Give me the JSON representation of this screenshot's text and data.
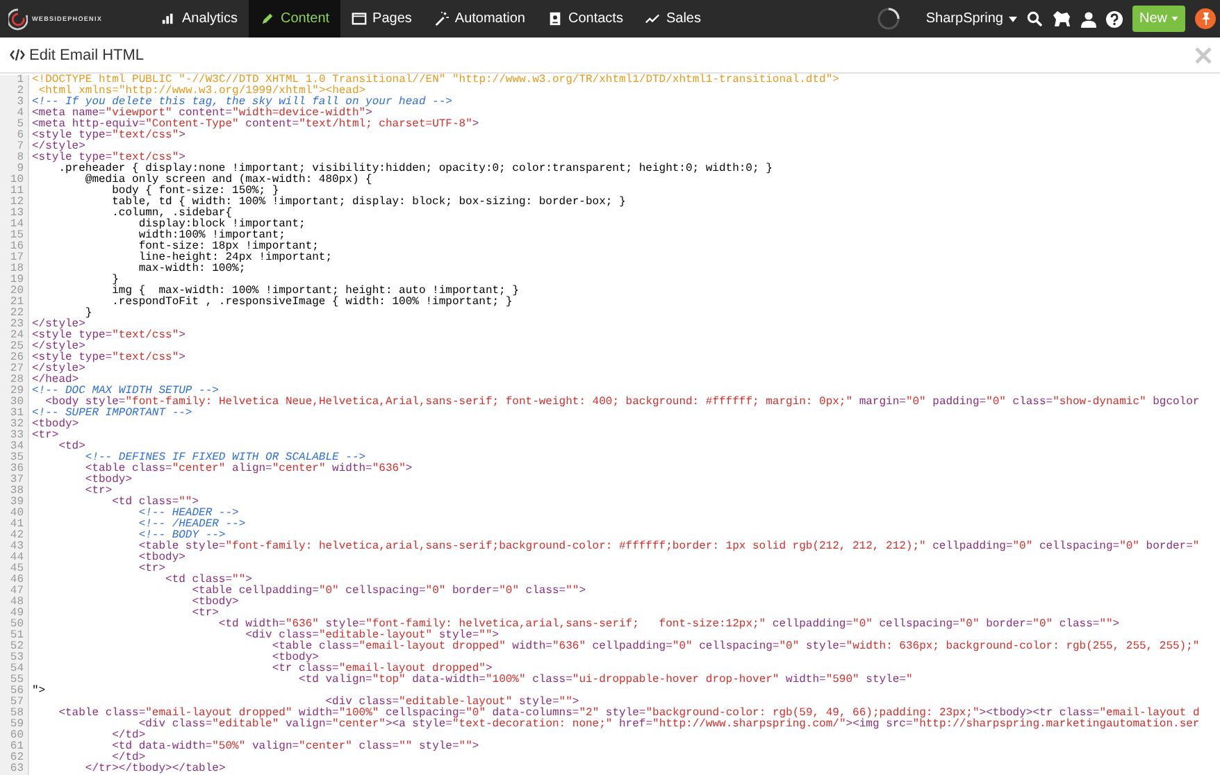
{
  "nav": {
    "logo_text": "WEBSIDEPHOENIX",
    "items": [
      {
        "label": "Analytics",
        "selected": false
      },
      {
        "label": "Content",
        "selected": true
      },
      {
        "label": "Pages",
        "selected": false
      },
      {
        "label": "Automation",
        "selected": false
      },
      {
        "label": "Contacts",
        "selected": false
      },
      {
        "label": "Sales",
        "selected": false
      }
    ],
    "account": "SharpSpring",
    "new_button": "New"
  },
  "editor": {
    "title": "Edit Email HTML",
    "lines": [
      {
        "n": "1",
        "kind": "doctype",
        "code": "<!DOCTYPE html PUBLIC \"-//W3C//DTD XHTML 1.0 Transitional//EN\" \"http://www.w3.org/TR/xhtml1/DTD/xhtml1-transitional.dtd\">"
      },
      {
        "n": "2",
        "kind": "doctype",
        "code": " <html xmlns=\"http://www.w3.org/1999/xhtml\"><head>"
      },
      {
        "n": "3",
        "kind": "code",
        "code": "<!-- If you delete this tag, the sky will fall on your head -->"
      },
      {
        "n": "4",
        "kind": "code",
        "code": "<meta name=\"viewport\" content=\"width=device-width\">"
      },
      {
        "n": "5",
        "kind": "code",
        "code": "<meta http-equiv=\"Content-Type\" content=\"text/html; charset=UTF-8\">"
      },
      {
        "n": "6",
        "kind": "code",
        "code": "<style type=\"text/css\">"
      },
      {
        "n": "7",
        "kind": "code",
        "code": "</style>"
      },
      {
        "n": "8",
        "kind": "code",
        "code": "<style type=\"text/css\">"
      },
      {
        "n": "9",
        "kind": "code",
        "code": "    .preheader { display:none !important; visibility:hidden; opacity:0; color:transparent; height:0; width:0; }"
      },
      {
        "n": "10",
        "kind": "code",
        "code": "        @media only screen and (max-width: 480px) {"
      },
      {
        "n": "11",
        "kind": "code",
        "code": "            body { font-size: 150%; }"
      },
      {
        "n": "12",
        "kind": "code",
        "code": "            table, td { width: 100% !important; display: block; box-sizing: border-box; }"
      },
      {
        "n": "13",
        "kind": "code",
        "code": "            .column, .sidebar{"
      },
      {
        "n": "14",
        "kind": "code",
        "code": "                display:block !important;"
      },
      {
        "n": "15",
        "kind": "code",
        "code": "                width:100% !important;"
      },
      {
        "n": "16",
        "kind": "code",
        "code": "                font-size: 18px !important;"
      },
      {
        "n": "17",
        "kind": "code",
        "code": "                line-height: 24px !important;"
      },
      {
        "n": "18",
        "kind": "code",
        "code": "                max-width: 100%;"
      },
      {
        "n": "19",
        "kind": "code",
        "code": "            }"
      },
      {
        "n": "20",
        "kind": "code",
        "code": "            img {  max-width: 100% !important; height: auto !important; }"
      },
      {
        "n": "21",
        "kind": "code",
        "code": "            .respondToFit , .responsiveImage { width: 100% !important; }"
      },
      {
        "n": "22",
        "kind": "code",
        "code": "        }"
      },
      {
        "n": "23",
        "kind": "code",
        "code": "</style>"
      },
      {
        "n": "24",
        "kind": "code",
        "code": "<style type=\"text/css\">"
      },
      {
        "n": "25",
        "kind": "code",
        "code": "</style>"
      },
      {
        "n": "26",
        "kind": "code",
        "code": "<style type=\"text/css\">"
      },
      {
        "n": "27",
        "kind": "code",
        "code": "</style>"
      },
      {
        "n": "28",
        "kind": "code",
        "code": "</head>"
      },
      {
        "n": "29",
        "kind": "code",
        "code": "<!-- DOC MAX WIDTH SETUP -->"
      },
      {
        "n": "30",
        "kind": "code",
        "code": "  <body style=\"font-family: Helvetica Neue,Helvetica,Arial,sans-serif; font-weight: 400; background: #ffffff; margin: 0px;\" margin=\"0\" padding=\"0\" class=\"show-dynamic\" bgcolor"
      },
      {
        "n": "31",
        "kind": "code",
        "code": "<!-- SUPER IMPORTANT -->"
      },
      {
        "n": "32",
        "kind": "code",
        "code": "<tbody>"
      },
      {
        "n": "33",
        "kind": "code",
        "code": "<tr>"
      },
      {
        "n": "34",
        "kind": "code",
        "code": "    <td>"
      },
      {
        "n": "35",
        "kind": "code",
        "code": "        <!-- DEFINES IF FIXED WITH OR SCALABLE -->"
      },
      {
        "n": "36",
        "kind": "code",
        "code": "        <table class=\"center\" align=\"center\" width=\"636\">"
      },
      {
        "n": "37",
        "kind": "code",
        "code": "        <tbody>"
      },
      {
        "n": "38",
        "kind": "code",
        "code": "        <tr>"
      },
      {
        "n": "39",
        "kind": "code",
        "code": "            <td class=\"\">"
      },
      {
        "n": "40",
        "kind": "code",
        "code": "                <!-- HEADER -->"
      },
      {
        "n": "41",
        "kind": "code",
        "code": "                <!-- /HEADER -->"
      },
      {
        "n": "42",
        "kind": "code",
        "code": "                <!-- BODY -->"
      },
      {
        "n": "43",
        "kind": "code",
        "code": "                <table style=\"font-family: helvetica,arial,sans-serif;background-color: #ffffff;border: 1px solid rgb(212, 212, 212);\" cellpadding=\"0\" cellspacing=\"0\" border=\""
      },
      {
        "n": "44",
        "kind": "code",
        "code": "                <tbody>"
      },
      {
        "n": "45",
        "kind": "code",
        "code": "                <tr>"
      },
      {
        "n": "46",
        "kind": "code",
        "code": "                    <td class=\"\">"
      },
      {
        "n": "47",
        "kind": "code",
        "code": "                        <table cellpadding=\"0\" cellspacing=\"0\" border=\"0\" class=\"\">"
      },
      {
        "n": "48",
        "kind": "code",
        "code": "                        <tbody>"
      },
      {
        "n": "49",
        "kind": "code",
        "code": "                        <tr>"
      },
      {
        "n": "50",
        "kind": "code",
        "code": "                            <td width=\"636\" style=\"font-family: helvetica,arial,sans-serif;   font-size:12px;\" cellpadding=\"0\" cellspacing=\"0\" border=\"0\" class=\"\">"
      },
      {
        "n": "51",
        "kind": "code",
        "code": "                                <div class=\"editable-layout\" style=\"\">"
      },
      {
        "n": "52",
        "kind": "code",
        "code": "                                    <table class=\"email-layout dropped\" width=\"636\" cellpadding=\"0\" cellspacing=\"0\" style=\"width: 636px; background-color: rgb(255, 255, 255);\""
      },
      {
        "n": "53",
        "kind": "code",
        "code": "                                    <tbody>"
      },
      {
        "n": "54",
        "kind": "code",
        "code": "                                    <tr class=\"email-layout dropped\">"
      },
      {
        "n": "55",
        "kind": "code",
        "code": "                                        <td valign=\"top\" data-width=\"100%\" class=\"ui-droppable-hover drop-hover\" width=\"590\" style=\""
      },
      {
        "n": "56",
        "kind": "code",
        "code": "\">"
      },
      {
        "n": "57",
        "kind": "code",
        "code": "                                            <div class=\"editable-layout\" style=\"\">"
      },
      {
        "n": "58",
        "kind": "code",
        "code": "    <table class=\"email-layout dropped\" width=\"100%\" cellspacing=\"0\" data-columns=\"2\" style=\"background-color: rgb(59, 49, 66);padding: 23px;\"><tbody><tr class=\"email-layout d"
      },
      {
        "n": "59",
        "kind": "code",
        "code": "                <div class=\"editable\" valign=\"center\"><a style=\"text-decoration: none;\" href=\"http://www.sharpspring.com/\"><img src=\"http://sharpspring.marketingautomation.ser"
      },
      {
        "n": "60",
        "kind": "code",
        "code": "            </td>"
      },
      {
        "n": "61",
        "kind": "code",
        "code": "            <td data-width=\"50%\" valign=\"center\" class=\"\" style=\"\">"
      },
      {
        "n": "62",
        "kind": "code",
        "code": "            </td>"
      },
      {
        "n": "63",
        "kind": "code",
        "code": "        </tr></tbody></table>"
      }
    ]
  }
}
